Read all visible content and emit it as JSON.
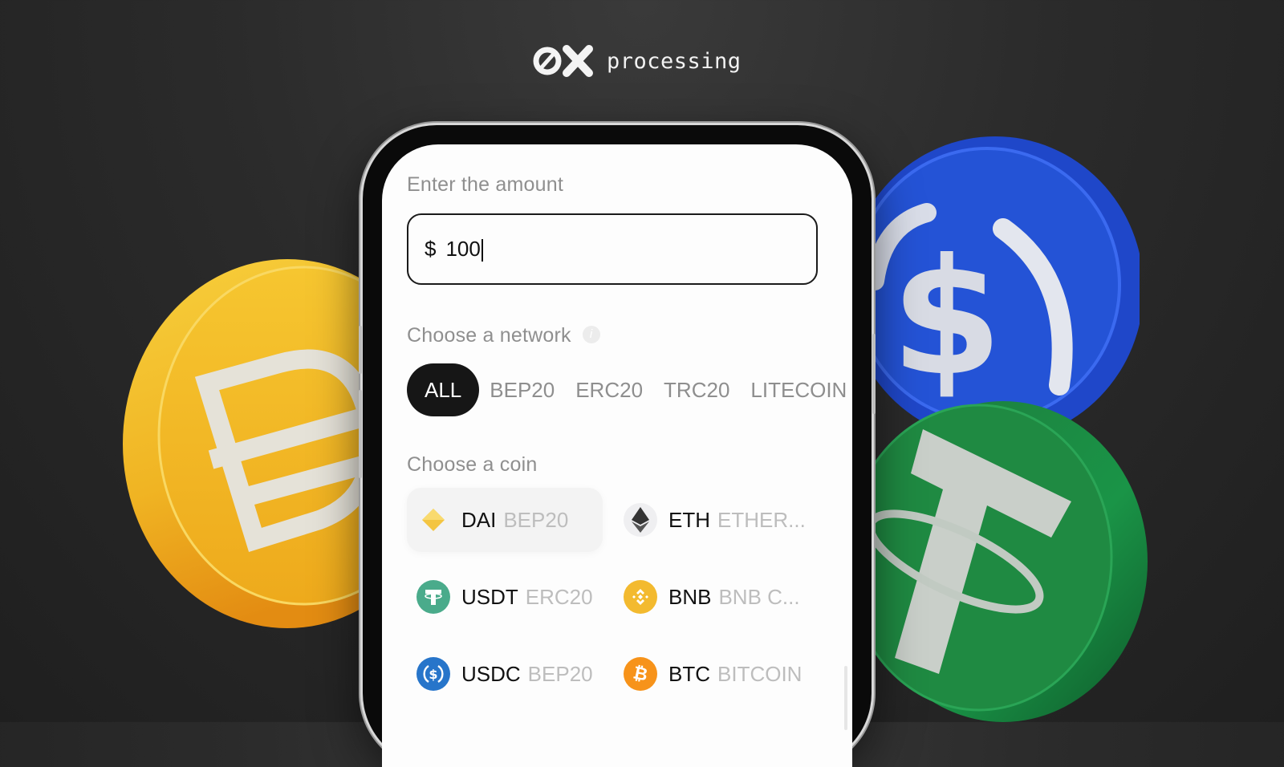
{
  "brand": {
    "name": "processing",
    "logo": "0x-logo"
  },
  "colors": {
    "background": "#2b2b2b",
    "accent_dark": "#161616",
    "label": "#8f8f8f",
    "muted": "#bdbdbd",
    "dai": "#f4b731",
    "usdc": "#2775ca",
    "usdt": "#26a17b",
    "bnb": "#f3ba2f",
    "btc": "#f7931a",
    "eth": "#3c3c3d"
  },
  "form": {
    "amount_label": "Enter the amount",
    "currency_symbol": "$",
    "amount_value": "100",
    "network_label": "Choose a network",
    "network_info_icon": "info-icon",
    "networks": [
      {
        "label": "ALL",
        "active": true
      },
      {
        "label": "BEP20",
        "active": false
      },
      {
        "label": "ERC20",
        "active": false
      },
      {
        "label": "TRC20",
        "active": false
      },
      {
        "label": "LITECOIN",
        "active": false
      }
    ],
    "coin_label": "Choose a coin",
    "coins": [
      {
        "symbol": "DAI",
        "network": "BEP20",
        "icon": "dai-icon",
        "selected": true
      },
      {
        "symbol": "ETH",
        "network": "ETHER...",
        "icon": "eth-icon",
        "selected": false
      },
      {
        "symbol": "USDT",
        "network": "ERC20",
        "icon": "usdt-icon",
        "selected": false
      },
      {
        "symbol": "BNB",
        "network": "BNB C...",
        "icon": "bnb-icon",
        "selected": false
      },
      {
        "symbol": "USDC",
        "network": "BEP20",
        "icon": "usdc-icon",
        "selected": false
      },
      {
        "symbol": "BTC",
        "network": "BITCOIN",
        "icon": "btc-icon",
        "selected": false
      }
    ]
  },
  "decor": {
    "coins": [
      "dai-3d-coin",
      "usdc-3d-coin",
      "usdt-3d-coin"
    ]
  }
}
